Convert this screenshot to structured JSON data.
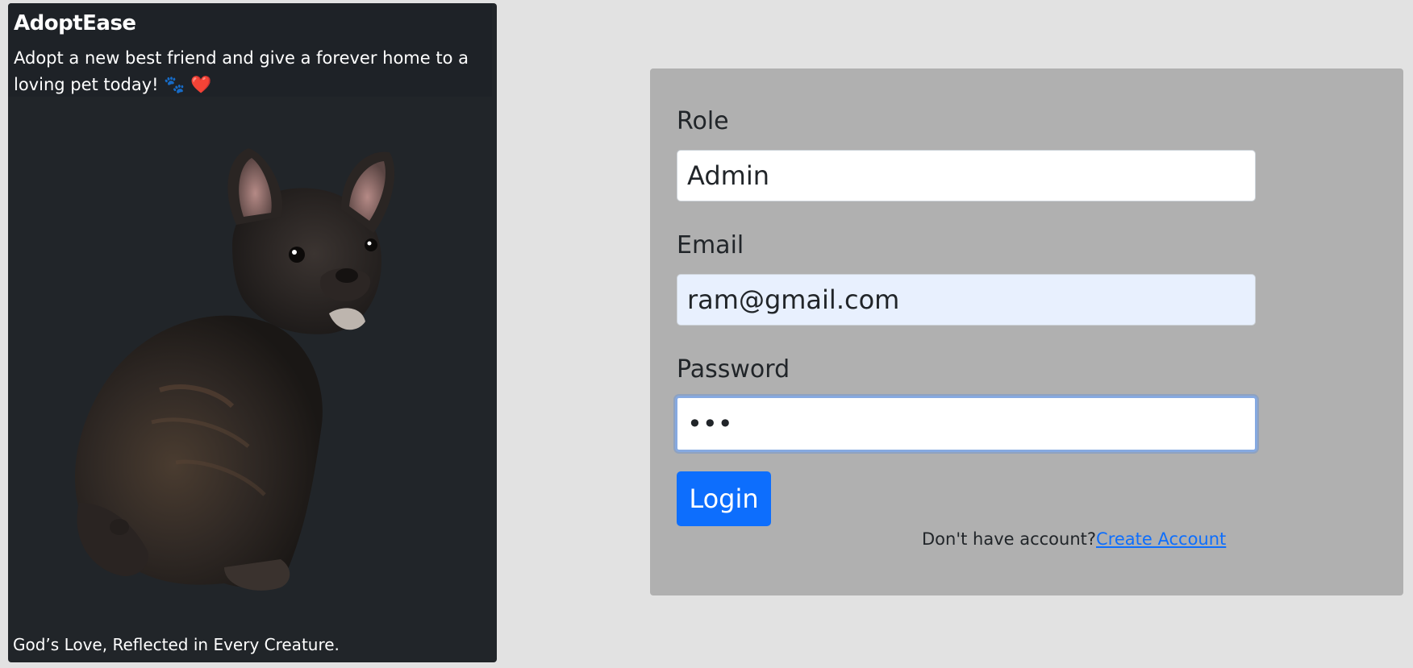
{
  "hero": {
    "title": "AdoptEase",
    "subtitle": "Adopt a new best friend and give a forever home to a loving pet today! 🐾 ❤️",
    "footer": "God’s Love, Reflected in Every Creature."
  },
  "login": {
    "role": {
      "label": "Role",
      "value": "Admin"
    },
    "email": {
      "label": "Email",
      "value": "ram@gmail.com"
    },
    "password": {
      "label": "Password",
      "value": "•••"
    },
    "login_button": "Login",
    "signup_prompt": "Don't have account?",
    "signup_link": "Create Account"
  },
  "colors": {
    "hero_bg": "#212529",
    "panel_bg": "#b0b0b0",
    "page_bg": "#e2e2e2",
    "primary": "#0d6efd",
    "autofill_bg": "#e8f0fe"
  }
}
